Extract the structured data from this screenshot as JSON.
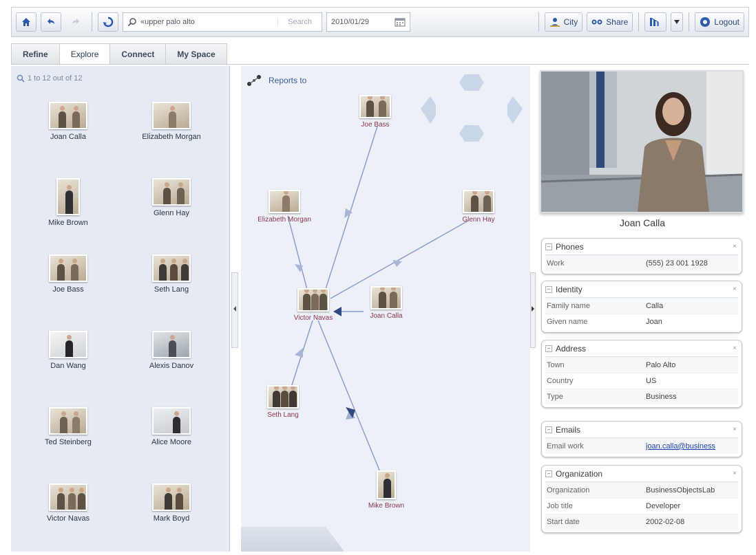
{
  "toolbar": {
    "search_value": "«upper palo alto",
    "search_label": "Search",
    "date_value": "2010/01/29",
    "city_label": "City",
    "share_label": "Share",
    "logout_label": "Logout"
  },
  "tabs": [
    {
      "label": "Refine"
    },
    {
      "label": "Explore",
      "active": true
    },
    {
      "label": "Connect"
    },
    {
      "label": "My Space"
    }
  ],
  "results": {
    "count_text": "1 to 12 out of 12",
    "items": [
      {
        "name": "Joan Calla"
      },
      {
        "name": "Elizabeth Morgan"
      },
      {
        "name": "Mike Brown"
      },
      {
        "name": "Glenn Hay"
      },
      {
        "name": "Joe Bass"
      },
      {
        "name": "Seth Lang"
      },
      {
        "name": "Dan Wang"
      },
      {
        "name": "Alexis Danov"
      },
      {
        "name": "Ted Steinberg"
      },
      {
        "name": "Alice Moore"
      },
      {
        "name": "Victor Navas"
      },
      {
        "name": "Mark Boyd"
      }
    ]
  },
  "graph": {
    "title": "Reports to",
    "nodes": [
      {
        "id": "joe",
        "label": "Joe Bass"
      },
      {
        "id": "elizabeth",
        "label": "Elizabeth Morgan"
      },
      {
        "id": "glenn",
        "label": "Glenn Hay"
      },
      {
        "id": "victor",
        "label": "Victor Navas"
      },
      {
        "id": "joan",
        "label": "Joan Calla"
      },
      {
        "id": "seth",
        "label": "Seth Lang"
      },
      {
        "id": "mike",
        "label": "Mike Brown"
      }
    ]
  },
  "profile": {
    "name": "Joan Calla",
    "phones": {
      "title": "Phones",
      "rows": [
        {
          "k": "Work",
          "v": "(555) 23 001 1928"
        }
      ]
    },
    "identity": {
      "title": "Identity",
      "rows": [
        {
          "k": "Family name",
          "v": "Calla"
        },
        {
          "k": "Given name",
          "v": "Joan"
        }
      ]
    },
    "address": {
      "title": "Address",
      "rows": [
        {
          "k": "Town",
          "v": "Palo Alto"
        },
        {
          "k": "Country",
          "v": "US"
        },
        {
          "k": "Type",
          "v": "Business"
        }
      ]
    },
    "emails": {
      "title": "Emails",
      "rows": [
        {
          "k": "Email work",
          "v": "joan.calla@business"
        }
      ]
    },
    "organization": {
      "title": "Organization",
      "rows": [
        {
          "k": "Organization",
          "v": "BusinessObjectsLab"
        },
        {
          "k": "Job title",
          "v": "Developer"
        },
        {
          "k": "Start date",
          "v": "2002-02-08"
        }
      ]
    }
  }
}
